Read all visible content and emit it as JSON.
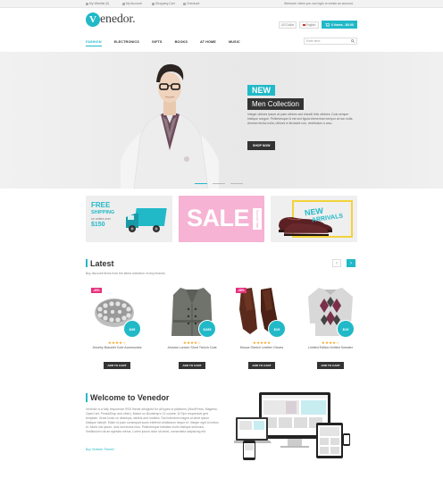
{
  "topbar": {
    "links": [
      "My Wishlist (0)",
      "My Account",
      "Shopping Cart",
      "Checkout"
    ],
    "welcome": "Welcome visitor you can login or create an account."
  },
  "header": {
    "logo_letter": "V",
    "logo_text": "enedor.",
    "currency": "US Dollar",
    "language": "English",
    "cart_label": "0 items - $0.00"
  },
  "nav": {
    "items": [
      "FASHION",
      "ELECTRONICS",
      "GIFTS",
      "BOOKS",
      "AT HOME",
      "MUSIC"
    ],
    "search_placeholder": "Enter term"
  },
  "hero": {
    "badge": "NEW",
    "title": "Men Collection",
    "description": "Integer ultrices ipsum at justo ultrices sed blandit felis ultricies. Duis semper tristique congue. Pellentesque id est sed ligula elementum tempor at non nulla. Aenean lectus nulla, ultrices in tincidunt non, vestibulum a arcu.",
    "button": "SHOP NOW"
  },
  "promos": {
    "free_line1": "FREE",
    "free_line2": "SHIPPING",
    "free_line3": "on orders over",
    "free_amount": "$150",
    "sale_text": "SALE",
    "sale_side": "Summer Sale",
    "arrivals_line1": "NEW",
    "arrivals_line2": "ARRIVALS"
  },
  "latest": {
    "title": "Latest",
    "subtitle": "Buy discount items from the latest collection of vinyl brands",
    "prev": "‹",
    "next": "›"
  },
  "products": [
    {
      "name": "Jewelry Bracelet Cute Accessories",
      "price": "$49",
      "sale": "-43%",
      "rating": "★★★★☆",
      "button": "ADD TO CART"
    },
    {
      "name": "Jessica London Short Trench Coat",
      "price": "$435",
      "sale": "",
      "rating": "★★★★☆",
      "button": "ADD TO CART"
    },
    {
      "name": "Mocca Stretch Leather Gloves",
      "price": "$19",
      "sale": "-38%",
      "rating": "★★★★★",
      "button": "ADD TO CART"
    },
    {
      "name": "Limited Edition Knitted Sweater",
      "price": "$19",
      "sale": "",
      "rating": "★★★★☆",
      "button": "ADD TO CART"
    }
  ],
  "welcome": {
    "title": "Welcome to Venedor",
    "body": "Venedor is a fully responsive RSS theme designed for all types of platforms (WordPress, Magento, OpenCart, PrestaShop and other). Based on Bootstrap's 12 column 1170px responsive grid template. Great looks on desktops, tablets and mobiles. Sed interdum magna at amet ipsum tristique blandit. Etiam id justo consequat suam eleifend vestibulum neque et. Integer eget id metus et. Morbi nisl ipsum, duis sed lectus mus. Pellentesque habitant morbi tristique senectus. Vestibulum rutrum egestas metus. Lorem ipsum dolor sit amet, consectetur adipiscing elit.",
    "link": "Buy Venedor Theme!"
  },
  "colors": {
    "accent": "#21b9c8",
    "dark": "#333333",
    "pink": "#f6b3d4",
    "sale": "#e6317e",
    "star": "#f5a623"
  }
}
